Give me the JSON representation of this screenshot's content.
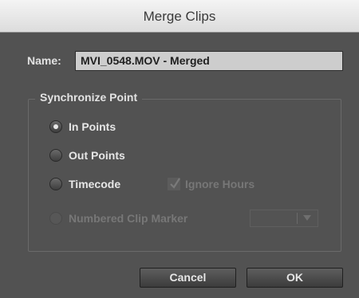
{
  "window": {
    "title": "Merge Clips"
  },
  "name_field": {
    "label": "Name:",
    "value": "MVI_0548.MOV - Merged"
  },
  "sync_group": {
    "title": "Synchronize Point",
    "options": [
      {
        "label": "In Points",
        "checked": true,
        "enabled": true
      },
      {
        "label": "Out Points",
        "checked": false,
        "enabled": true
      },
      {
        "label": "Timecode",
        "checked": false,
        "enabled": true
      },
      {
        "label": "Numbered Clip Marker",
        "checked": false,
        "enabled": false
      }
    ],
    "ignore_hours": {
      "label": "Ignore Hours",
      "checked": true,
      "enabled": false
    },
    "marker_dropdown": {
      "value": "",
      "enabled": false
    }
  },
  "buttons": {
    "cancel": "Cancel",
    "ok": "OK"
  },
  "icons": {
    "radio": "radio-button-icon",
    "checkbox": "checkmark-icon",
    "dropdown": "chevron-down-icon"
  },
  "colors": {
    "dialog_bg": "#525252",
    "titlebar_bg": "#e6e6e6",
    "field_bg": "#cdcdcd"
  }
}
